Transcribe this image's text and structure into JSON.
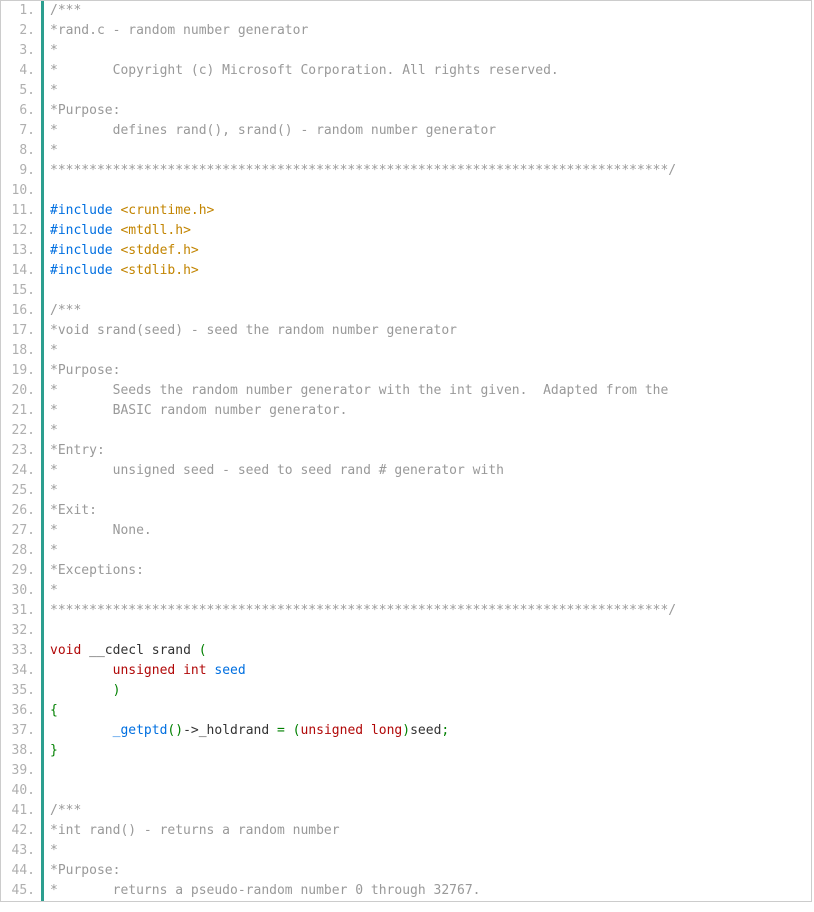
{
  "code": {
    "lines": [
      {
        "n": 1,
        "tokens": [
          {
            "t": "/***",
            "c": "c-comment"
          }
        ]
      },
      {
        "n": 2,
        "tokens": [
          {
            "t": "*rand.c - random number generator",
            "c": "c-comment"
          }
        ]
      },
      {
        "n": 3,
        "tokens": [
          {
            "t": "*",
            "c": "c-comment"
          }
        ]
      },
      {
        "n": 4,
        "tokens": [
          {
            "t": "*       Copyright (c) Microsoft Corporation. All rights reserved.",
            "c": "c-comment"
          }
        ]
      },
      {
        "n": 5,
        "tokens": [
          {
            "t": "*",
            "c": "c-comment"
          }
        ]
      },
      {
        "n": 6,
        "tokens": [
          {
            "t": "*Purpose:",
            "c": "c-comment"
          }
        ]
      },
      {
        "n": 7,
        "tokens": [
          {
            "t": "*       defines rand(), srand() - random number generator",
            "c": "c-comment"
          }
        ]
      },
      {
        "n": 8,
        "tokens": [
          {
            "t": "*",
            "c": "c-comment"
          }
        ]
      },
      {
        "n": 9,
        "tokens": [
          {
            "t": "*******************************************************************************/",
            "c": "c-comment"
          }
        ]
      },
      {
        "n": 10,
        "tokens": []
      },
      {
        "n": 11,
        "tokens": [
          {
            "t": "#include ",
            "c": "c-kw"
          },
          {
            "t": "<cruntime.h>",
            "c": "c-str"
          }
        ]
      },
      {
        "n": 12,
        "tokens": [
          {
            "t": "#include ",
            "c": "c-kw"
          },
          {
            "t": "<mtdll.h>",
            "c": "c-str"
          }
        ]
      },
      {
        "n": 13,
        "tokens": [
          {
            "t": "#include ",
            "c": "c-kw"
          },
          {
            "t": "<stddef.h>",
            "c": "c-str"
          }
        ]
      },
      {
        "n": 14,
        "tokens": [
          {
            "t": "#include ",
            "c": "c-kw"
          },
          {
            "t": "<stdlib.h>",
            "c": "c-str"
          }
        ]
      },
      {
        "n": 15,
        "tokens": []
      },
      {
        "n": 16,
        "tokens": [
          {
            "t": "/***",
            "c": "c-comment"
          }
        ]
      },
      {
        "n": 17,
        "tokens": [
          {
            "t": "*void srand(seed) - seed the random number generator",
            "c": "c-comment"
          }
        ]
      },
      {
        "n": 18,
        "tokens": [
          {
            "t": "*",
            "c": "c-comment"
          }
        ]
      },
      {
        "n": 19,
        "tokens": [
          {
            "t": "*Purpose:",
            "c": "c-comment"
          }
        ]
      },
      {
        "n": 20,
        "tokens": [
          {
            "t": "*       Seeds the random number generator with the int given.  Adapted from the",
            "c": "c-comment"
          }
        ]
      },
      {
        "n": 21,
        "tokens": [
          {
            "t": "*       BASIC random number generator.",
            "c": "c-comment"
          }
        ]
      },
      {
        "n": 22,
        "tokens": [
          {
            "t": "*",
            "c": "c-comment"
          }
        ]
      },
      {
        "n": 23,
        "tokens": [
          {
            "t": "*Entry:",
            "c": "c-comment"
          }
        ]
      },
      {
        "n": 24,
        "tokens": [
          {
            "t": "*       unsigned seed - seed to seed rand # generator with",
            "c": "c-comment"
          }
        ]
      },
      {
        "n": 25,
        "tokens": [
          {
            "t": "*",
            "c": "c-comment"
          }
        ]
      },
      {
        "n": 26,
        "tokens": [
          {
            "t": "*Exit:",
            "c": "c-comment"
          }
        ]
      },
      {
        "n": 27,
        "tokens": [
          {
            "t": "*       None.",
            "c": "c-comment"
          }
        ]
      },
      {
        "n": 28,
        "tokens": [
          {
            "t": "*",
            "c": "c-comment"
          }
        ]
      },
      {
        "n": 29,
        "tokens": [
          {
            "t": "*Exceptions:",
            "c": "c-comment"
          }
        ]
      },
      {
        "n": 30,
        "tokens": [
          {
            "t": "*",
            "c": "c-comment"
          }
        ]
      },
      {
        "n": 31,
        "tokens": [
          {
            "t": "*******************************************************************************/",
            "c": "c-comment"
          }
        ]
      },
      {
        "n": 32,
        "tokens": []
      },
      {
        "n": 33,
        "tokens": [
          {
            "t": "void",
            "c": "c-type"
          },
          {
            "t": " ",
            "c": ""
          },
          {
            "t": "__cdecl",
            "c": ""
          },
          {
            "t": " ",
            "c": ""
          },
          {
            "t": "srand",
            "c": ""
          },
          {
            "t": " ",
            "c": ""
          },
          {
            "t": "(",
            "c": "c-punc"
          }
        ]
      },
      {
        "n": 34,
        "tokens": [
          {
            "t": "        ",
            "c": ""
          },
          {
            "t": "unsigned",
            "c": "c-type"
          },
          {
            "t": " ",
            "c": ""
          },
          {
            "t": "int",
            "c": "c-type"
          },
          {
            "t": " ",
            "c": ""
          },
          {
            "t": "seed",
            "c": "c-name"
          }
        ]
      },
      {
        "n": 35,
        "tokens": [
          {
            "t": "        ",
            "c": ""
          },
          {
            "t": ")",
            "c": "c-punc"
          }
        ]
      },
      {
        "n": 36,
        "tokens": [
          {
            "t": "{",
            "c": "c-punc"
          }
        ]
      },
      {
        "n": 37,
        "tokens": [
          {
            "t": "        ",
            "c": ""
          },
          {
            "t": "_getptd",
            "c": "c-func"
          },
          {
            "t": "()",
            "c": "c-punc"
          },
          {
            "t": "->",
            "c": "c-arrow"
          },
          {
            "t": "_holdrand",
            "c": ""
          },
          {
            "t": " ",
            "c": ""
          },
          {
            "t": "=",
            "c": "c-punc"
          },
          {
            "t": " ",
            "c": ""
          },
          {
            "t": "(",
            "c": "c-punc"
          },
          {
            "t": "unsigned",
            "c": "c-type"
          },
          {
            "t": " ",
            "c": ""
          },
          {
            "t": "long",
            "c": "c-type"
          },
          {
            "t": ")",
            "c": "c-punc"
          },
          {
            "t": "seed",
            "c": ""
          },
          {
            "t": ";",
            "c": "c-punc"
          }
        ]
      },
      {
        "n": 38,
        "tokens": [
          {
            "t": "}",
            "c": "c-punc"
          }
        ]
      },
      {
        "n": 39,
        "tokens": []
      },
      {
        "n": 40,
        "tokens": []
      },
      {
        "n": 41,
        "tokens": [
          {
            "t": "/***",
            "c": "c-comment"
          }
        ]
      },
      {
        "n": 42,
        "tokens": [
          {
            "t": "*int rand() - returns a random number",
            "c": "c-comment"
          }
        ]
      },
      {
        "n": 43,
        "tokens": [
          {
            "t": "*",
            "c": "c-comment"
          }
        ]
      },
      {
        "n": 44,
        "tokens": [
          {
            "t": "*Purpose:",
            "c": "c-comment"
          }
        ]
      },
      {
        "n": 45,
        "tokens": [
          {
            "t": "*       returns a pseudo-random number 0 through 32767.",
            "c": "c-comment"
          }
        ]
      }
    ]
  }
}
